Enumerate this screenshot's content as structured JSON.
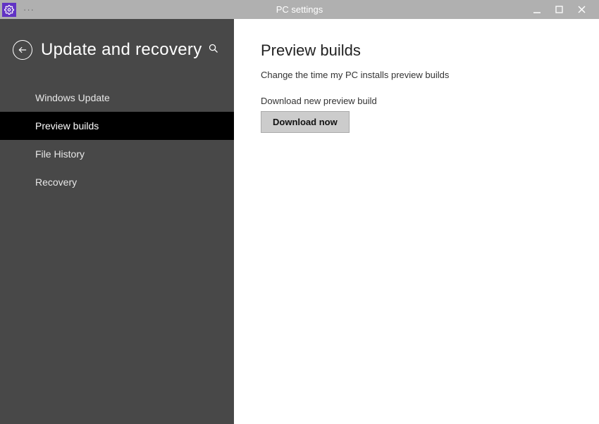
{
  "titlebar": {
    "title": "PC settings",
    "menu_label": "···"
  },
  "sidebar": {
    "title": "Update and recovery",
    "items": [
      {
        "label": "Windows Update"
      },
      {
        "label": "Preview builds"
      },
      {
        "label": "File History"
      },
      {
        "label": "Recovery"
      }
    ]
  },
  "main": {
    "title": "Preview builds",
    "description": "Change the time my PC installs preview builds",
    "download_label": "Download new preview build",
    "download_button": "Download now"
  }
}
